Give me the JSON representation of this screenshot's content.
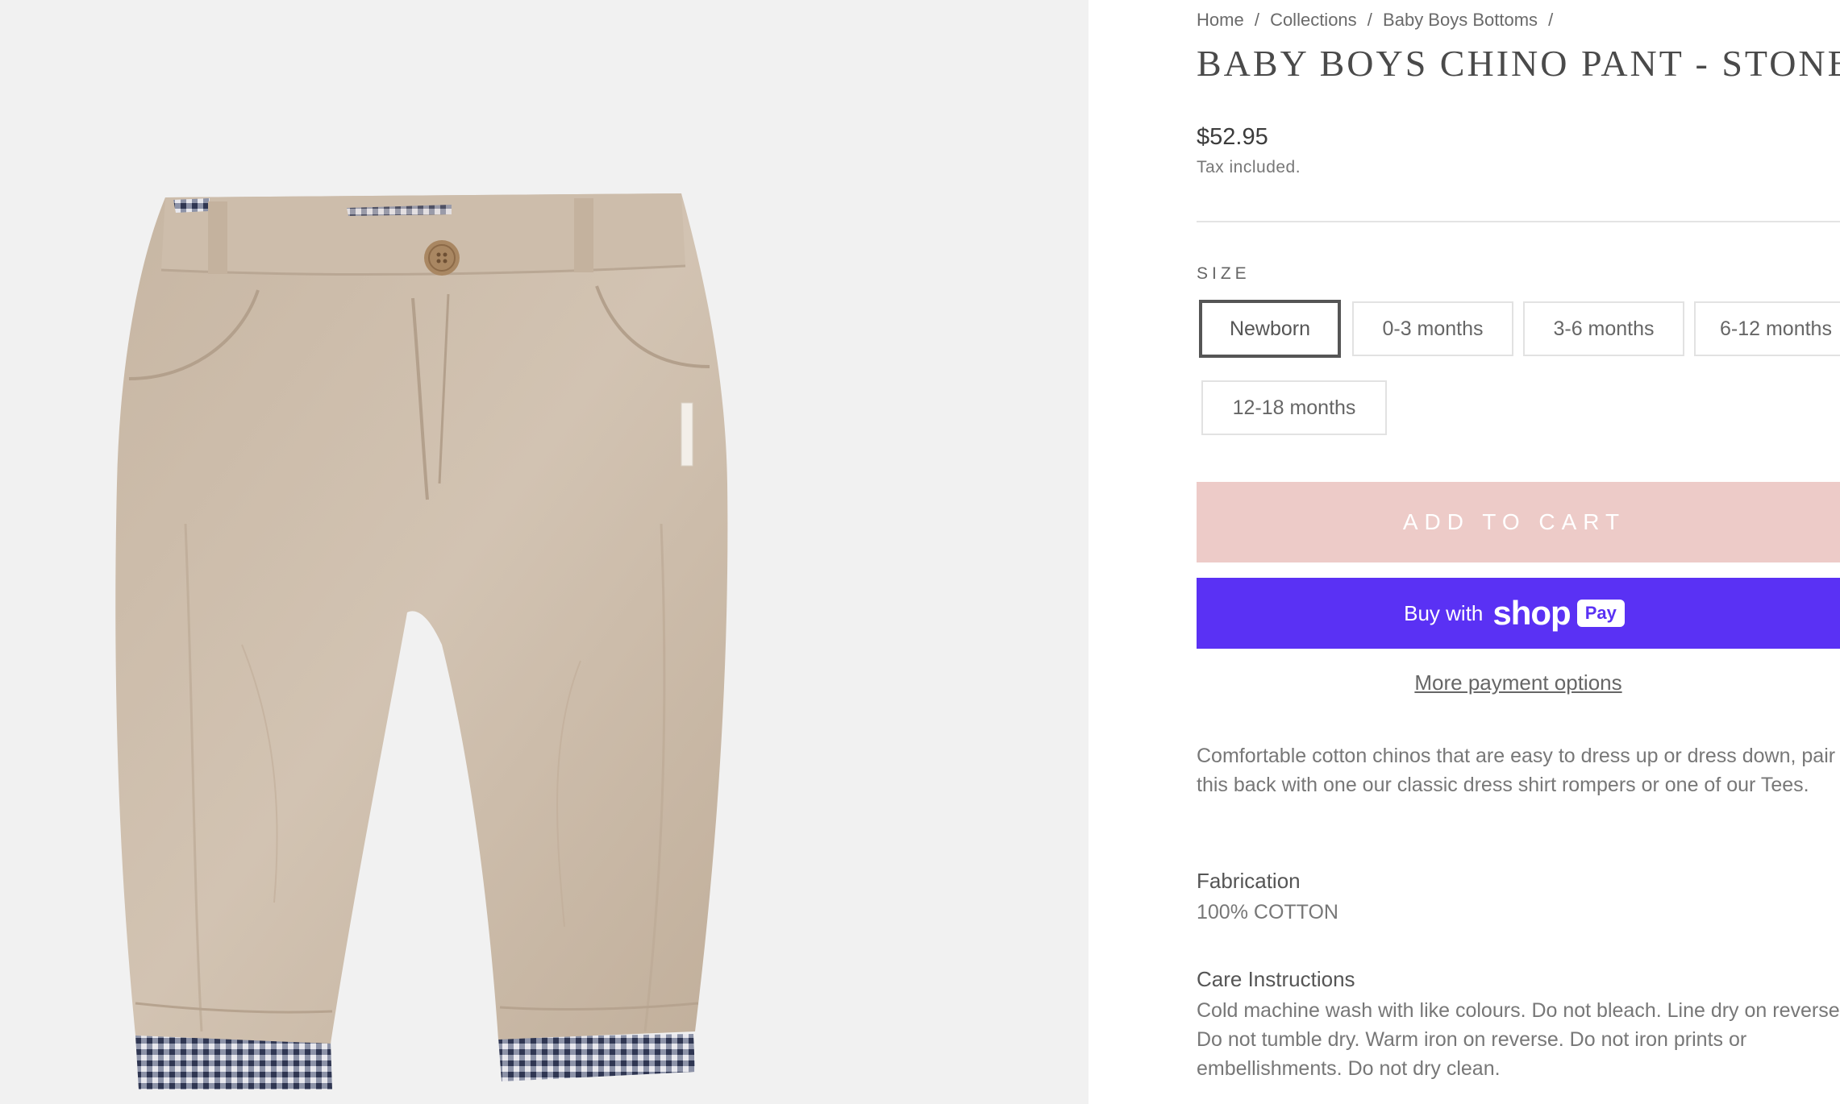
{
  "breadcrumb": {
    "items": [
      "Home",
      "Collections",
      "Baby Boys Bottoms"
    ],
    "separator": "/"
  },
  "product": {
    "title": "BABY BOYS CHINO PANT - STONE",
    "price": "$52.95",
    "tax_note": "Tax included.",
    "image_alt_icon": "product-photo-chino-pant"
  },
  "size": {
    "label": "SIZE",
    "options": [
      "Newborn",
      "0-3 months",
      "3-6 months",
      "6-12 months",
      "12-18 months"
    ],
    "selected": "Newborn"
  },
  "actions": {
    "add_to_cart": "ADD TO CART",
    "buy_with": "Buy with",
    "shop_logo": "shop",
    "pay_badge": "Pay",
    "more_payment": "More payment options"
  },
  "description": "Comfortable cotton chinos that are easy to dress up or dress down, pair this back with one our classic dress shirt rompers or one of our Tees.",
  "fabrication": {
    "title": "Fabrication",
    "text": "100% COTTON"
  },
  "care": {
    "title": "Care Instructions",
    "text": "Cold machine wash with like colours. Do not bleach. Line dry on reverse. Do not tumble dry. Warm iron on reverse. Do not iron prints or embellishments. Do not dry clean."
  },
  "colors": {
    "add_to_cart_bg": "#edcbc8",
    "shop_pay_bg": "#5a31f4",
    "gallery_bg": "#f1f1f1",
    "pant_fabric": "#cbbba9"
  }
}
